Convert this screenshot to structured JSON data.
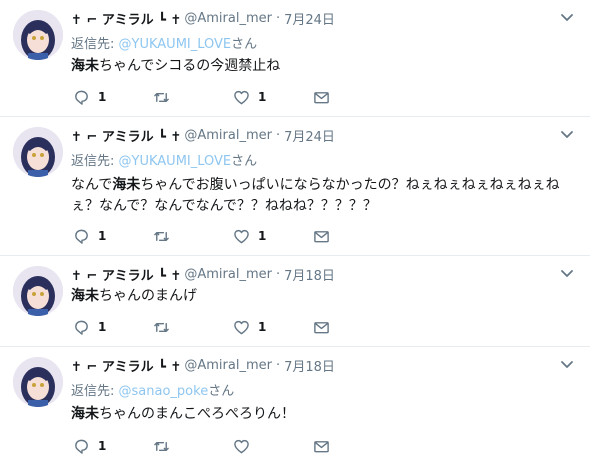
{
  "tweets": [
    {
      "name": "✝ ⌐ アミラル ┗ ✝",
      "handle": "@Amiral_mer",
      "dot": "·",
      "time": "7月24日",
      "reply_label": "返信先:",
      "reply_handle": "@YUKAUMI_LOVE",
      "reply_suffix": "さん",
      "text_bold": "海未",
      "text_line1": "ちゃんでシコるの今週禁止ね",
      "text_line2": "",
      "reply_count": "1",
      "retweet_count": "",
      "like_count": "1"
    },
    {
      "name": "✝ ⌐ アミラル ┗ ✝",
      "handle": "@Amiral_mer",
      "dot": "·",
      "time": "7月24日",
      "reply_label": "返信先:",
      "reply_handle": "@YUKAUMI_LOVE",
      "reply_suffix": "さん",
      "text_prefix": "なんで",
      "text_bold": "海未",
      "text_line1": "ちゃんでお腹いっぱいにならなかったの？ねぇねぇねぇねぇねぇね",
      "text_line2": "ぇ？なんで？なんでなんで？？ねねね？？？？？",
      "reply_count": "1",
      "retweet_count": "",
      "like_count": "1"
    },
    {
      "name": "✝ ⌐ アミラル ┗ ✝",
      "handle": "@Amiral_mer",
      "dot": "·",
      "time": "7月18日",
      "text_bold": "海未",
      "text_line1": "ちゃんのまんげ",
      "reply_count": "1",
      "retweet_count": "",
      "like_count": "1"
    },
    {
      "name": "✝ ⌐ アミラル ┗ ✝",
      "handle": "@Amiral_mer",
      "dot": "·",
      "time": "7月18日",
      "reply_label": "返信先:",
      "reply_handle": "@sanao_poke",
      "reply_suffix": "さん",
      "text_bold": "海未",
      "text_line1": "ちゃんのまんこぺろぺろりん！",
      "reply_count": "1",
      "retweet_count": "",
      "like_count": ""
    }
  ],
  "colors": {
    "name": "#14171a",
    "meta": "#657786",
    "mention": "#8ec6f0",
    "icon": "#657786",
    "divider": "#e6ecf0"
  },
  "icons": [
    "reply-icon",
    "retweet-icon",
    "like-icon",
    "message-icon",
    "chevron-down-icon"
  ]
}
